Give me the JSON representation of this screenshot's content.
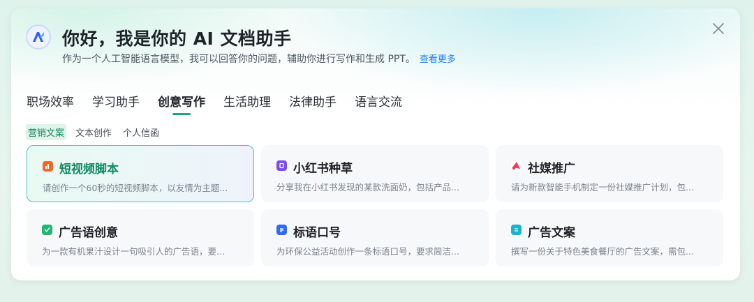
{
  "header": {
    "title": "你好，我是你的 AI 文档助手",
    "subtitle": "作为一个人工智能语言模型，我可以回答你的问题，辅助你进行写作和生成 PPT。",
    "more_link": "查看更多"
  },
  "tabs": [
    {
      "label": "职场效率",
      "active": false
    },
    {
      "label": "学习助手",
      "active": false
    },
    {
      "label": "创意写作",
      "active": true
    },
    {
      "label": "生活助理",
      "active": false
    },
    {
      "label": "法律助手",
      "active": false
    },
    {
      "label": "语言交流",
      "active": false
    }
  ],
  "subtabs": [
    {
      "label": "营销文案",
      "active": true
    },
    {
      "label": "文本创作",
      "active": false
    },
    {
      "label": "个人信函",
      "active": false
    }
  ],
  "cards": [
    {
      "title": "短视频脚本",
      "desc": "请创作一个60秒的短视频脚本，以友情为主题...",
      "icon": "bar-chart-icon",
      "color": "#f2672a",
      "active": true
    },
    {
      "title": "小红书种草",
      "desc": "分享我在小红书发现的某款洗面奶，包括产品...",
      "icon": "book-icon",
      "color": "#7a4cf0",
      "active": false
    },
    {
      "title": "社媒推广",
      "desc": "请为新款智能手机制定一份社媒推广计划，包...",
      "icon": "megaphone-icon",
      "color": "#f23b55",
      "active": false
    },
    {
      "title": "广告语创意",
      "desc": "为一款有机果汁设计一句吸引人的广告语，要...",
      "icon": "leaf-icon",
      "color": "#22b573",
      "active": false
    },
    {
      "title": "标语口号",
      "desc": "为环保公益活动创作一条标语口号，要求简洁...",
      "icon": "document-icon",
      "color": "#2d6bf2",
      "active": false
    },
    {
      "title": "广告文案",
      "desc": "撰写一份关于特色美食餐厅的广告文案，需包...",
      "icon": "ad-icon",
      "color": "#17b6c8",
      "active": false
    }
  ]
}
